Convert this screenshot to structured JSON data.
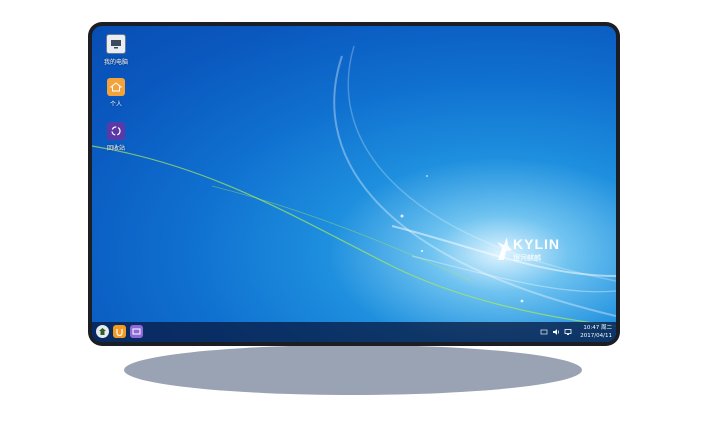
{
  "desktop": {
    "icons": [
      {
        "label": "我的电脑",
        "icon": "computer-icon"
      },
      {
        "label": "个人",
        "icon": "home-folder-icon"
      },
      {
        "label": "回收站",
        "icon": "recycle-bin-icon"
      }
    ],
    "logo": {
      "word": "KYLIN",
      "subtitle": "银河麒麟"
    }
  },
  "taskbar": {
    "start_icon": "start-menu-icon",
    "pinned": [
      "browser-icon",
      "file-manager-icon"
    ],
    "tray": [
      "network-icon",
      "volume-icon",
      "display-icon"
    ],
    "time": "10:47 周二",
    "date": "2017/04/11"
  },
  "colors": {
    "wallpaper_base": "#0a58bf",
    "wallpaper_glow": "#6fc3f0",
    "accent_green": "#9be34a",
    "taskbar": "#081c46"
  }
}
